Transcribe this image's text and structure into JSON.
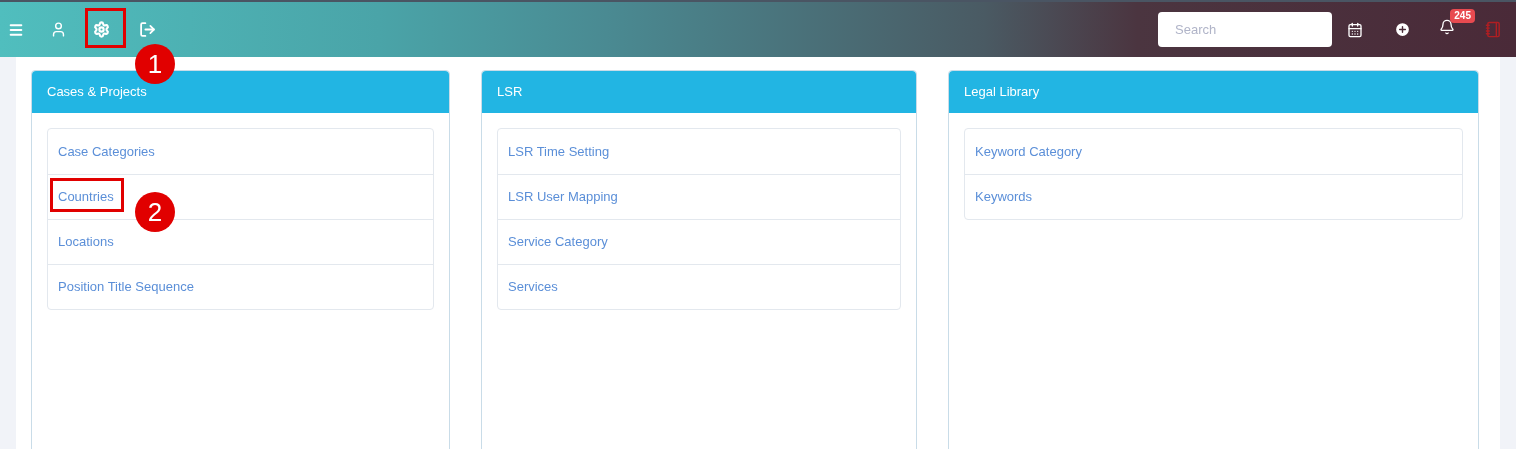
{
  "topbar": {
    "search": {
      "placeholder": "Search"
    },
    "notifications_badge": "245"
  },
  "panels": [
    {
      "title": "Cases & Projects",
      "items": [
        "Case Categories",
        "Countries",
        "Locations",
        "Position Title Sequence"
      ]
    },
    {
      "title": "LSR",
      "items": [
        "LSR Time Setting",
        "LSR User Mapping",
        "Service Category",
        "Services"
      ]
    },
    {
      "title": "Legal Library",
      "items": [
        "Keyword Category",
        "Keywords"
      ]
    }
  ],
  "annotations": [
    {
      "number": "1"
    },
    {
      "number": "2"
    }
  ]
}
